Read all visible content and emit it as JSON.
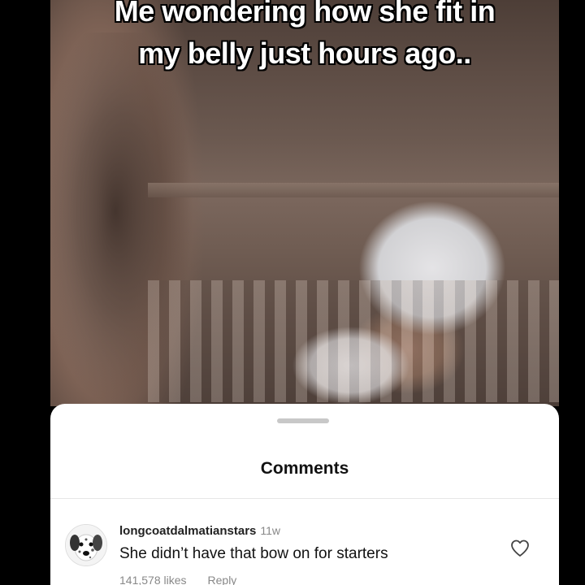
{
  "video": {
    "caption_line1": "Me wondering how she fit in",
    "caption_line2": "my belly just hours ago.."
  },
  "comments_sheet": {
    "title": "Comments",
    "comments": [
      {
        "username": "longcoatdalmatianstars",
        "time": "11w",
        "text": "She didn’t have that bow on for starters",
        "likes": "141,578 likes",
        "reply_label": "Reply",
        "avatar_icon": "dalmatian-avatar",
        "like_icon": "heart-outline-icon"
      }
    ]
  }
}
